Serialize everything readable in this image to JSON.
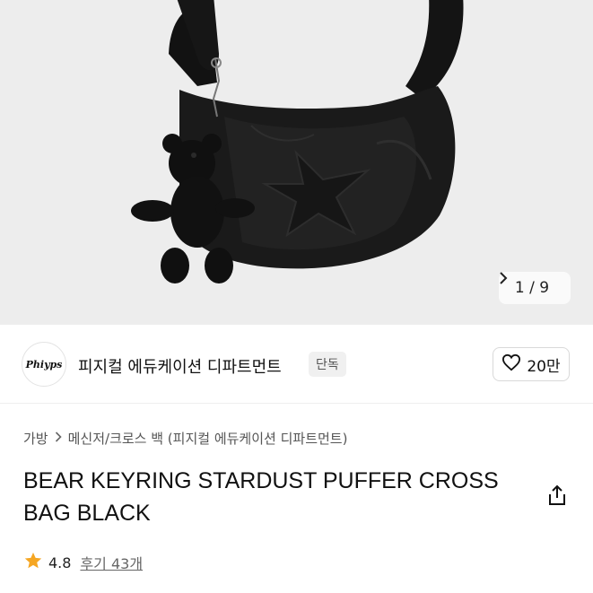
{
  "gallery": {
    "image_alt": "BEAR KEYRING STARDUST PUFFER CROSS BAG BLACK",
    "counter": "1 / 9",
    "next_icon": "chevron-right-icon"
  },
  "brand": {
    "logo_text": "Phiyps",
    "name": "피지컬 에듀케이션 디파트먼트",
    "tag": "단독"
  },
  "like": {
    "icon": "heart-outline-icon",
    "count": "20만"
  },
  "breadcrumb": {
    "items": [
      "가방",
      "메신저/크로스 백 (피지컬 에듀케이션 디파트먼트)"
    ],
    "separator_icon": "chevron-right-icon"
  },
  "product": {
    "title_line1": "BEAR KEYRING STARDUST PUFFER CROSS",
    "title_line2": "BAG BLACK",
    "share_icon": "share-icon"
  },
  "rating": {
    "icon": "star-icon",
    "star_color": "#f5a623",
    "score": "4.8",
    "reviews": "후기 43개"
  }
}
